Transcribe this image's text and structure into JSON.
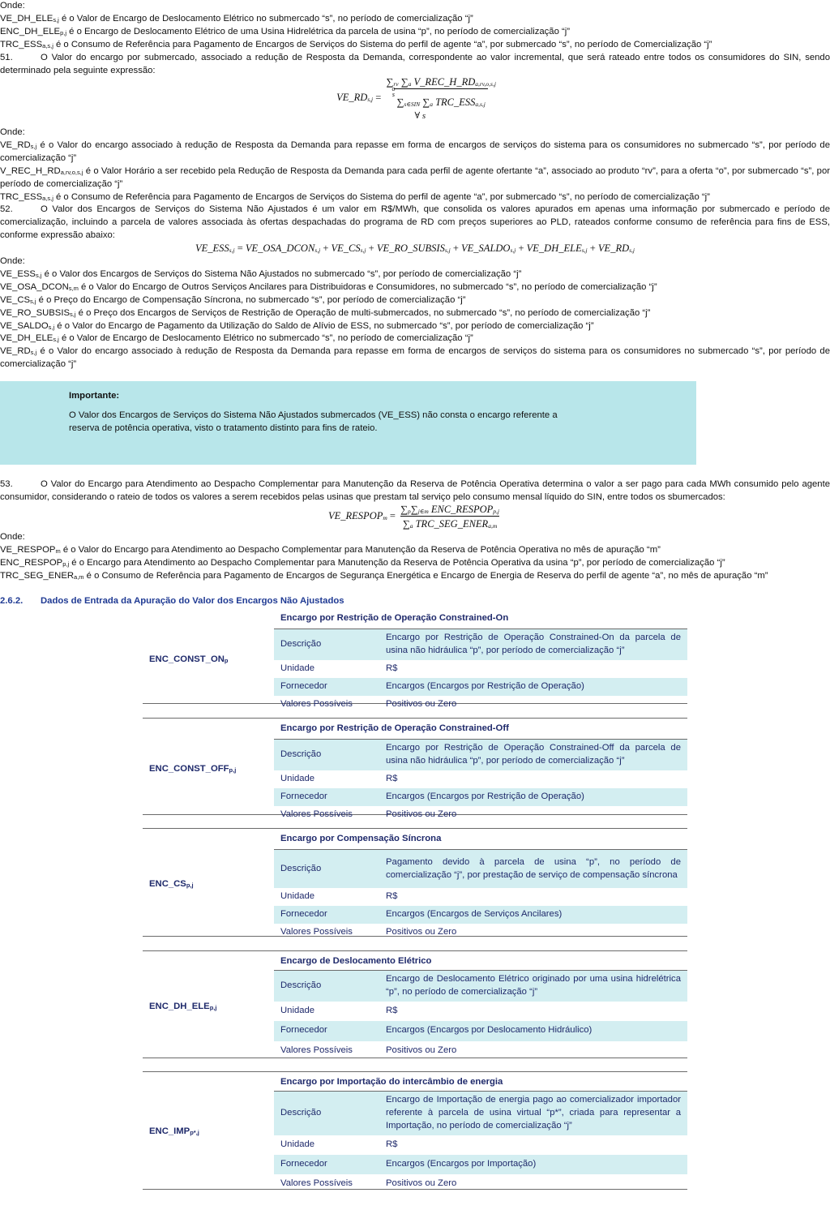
{
  "intro": {
    "onde": "Onde:",
    "defs1": [
      {
        "sym": "VE_DH_ELE",
        "sub": "s,j",
        "text": " é o Valor de Encargo de Deslocamento Elétrico no submercado “s”, no período de comercialização “j”"
      },
      {
        "sym": "ENC_DH_ELE",
        "sub": "p,j",
        "text": " é o Encargo de Deslocamento Elétrico de uma Usina Hidrelétrica da parcela de usina “p”, no período de comercialização “j”"
      },
      {
        "sym": "TRC_ESS",
        "sub": "a,s,j",
        "text": " é o Consumo de Referência para Pagamento de Encargos de Serviços do Sistema do perfil de agente “a”, por submercado “s”, no período de Comercialização “j”"
      }
    ]
  },
  "item51": {
    "num": "51.",
    "text": "O Valor do encargo por submercado, associado a redução de Resposta da Demanda, correspondente ao valor incremental, que será rateado entre todos os consumidores do SIN, sendo determinado pela seguinte expressão:",
    "eq_lhs": "VE_RD",
    "eq_lhs_sub": "s,j",
    "eq_num_a": "∑",
    "eq_num_rv": "rv",
    "eq_num_o": "o",
    "eq_num_s": "s",
    "eq_num_b": "∑",
    "eq_num_a2": "a",
    "eq_num_term": "V_REC_H_RD",
    "eq_num_sub": "a,rv,o,s,j",
    "eq_den_sum1": "∑",
    "eq_den_sub1": "s∈SIN",
    "eq_den_sum2": "∑",
    "eq_den_sub2": "a",
    "eq_den_term": "TRC_ESS",
    "eq_den_sub": "a,s,j",
    "eq_forall": "∀ s",
    "onde": "Onde:",
    "defs": [
      {
        "sym": "VE_RD",
        "sub": "s,j",
        "text": " é o Valor do encargo associado à redução de Resposta da Demanda para repasse em forma de encargos de serviços do sistema para os consumidores no submercado “s”, por período de comercialização “j”"
      },
      {
        "sym": "V_REC_H_RD",
        "sub": "a,rv,o,s,j",
        "text": " é o Valor Horário a ser recebido pela Redução de Resposta da Demanda para cada perfil de agente ofertante “a”, associado ao produto “rv”, para a oferta “o”, por submercado “s”, por período de comercialização “j”"
      },
      {
        "sym": "TRC_ESS",
        "sub": "a,s,j",
        "text": " é o Consumo de Referência para Pagamento de Encargos de Serviços do Sistema do perfil de agente “a”, por submercado “s”, no período de comercialização “j”"
      }
    ]
  },
  "item52": {
    "num": "52.",
    "text": "O Valor dos Encargos de Serviços do Sistema Não Ajustados é um valor em R$/MWh, que consolida os valores apurados em apenas uma informação por submercado e período de comercialização, incluindo a parcela de valores associada às ofertas despachadas do programa de RD com preços superiores ao PLD, rateados conforme consumo de referência para fins de ESS, conforme expressão abaixo:",
    "eq": [
      {
        "t": "VE_ESS",
        "s": "s,j"
      },
      {
        "op": " = "
      },
      {
        "t": "VE_OSA_DCON",
        "s": "s,j"
      },
      {
        "op": " + "
      },
      {
        "t": "VE_CS",
        "s": "s,j"
      },
      {
        "op": " + "
      },
      {
        "t": "VE_RO_SUBSIS",
        "s": "s,j"
      },
      {
        "op": " + "
      },
      {
        "t": "VE_SALDO",
        "s": "s,j"
      },
      {
        "op": " + "
      },
      {
        "t": "VE_DH_ELE",
        "s": "s,j"
      },
      {
        "op": " + "
      },
      {
        "t": "VE_RD",
        "s": "s,j"
      }
    ],
    "onde": "Onde:",
    "defs": [
      {
        "sym": "VE_ESS",
        "sub": "s,j",
        "text": " é o Valor dos Encargos de Serviços do Sistema Não Ajustados no submercado “s”, por período de comercialização “j”"
      },
      {
        "sym": "VE_OSA_DCON",
        "sub": "s,m",
        "text": " é o Valor do Encargo de Outros Serviços Ancilares para Distribuidoras e Consumidores, no submercado “s”, no período de comercialização “j”"
      },
      {
        "sym": "VE_CS",
        "sub": "s,j",
        "text": " é o Preço do Encargo de Compensação Síncrona, no submercado “s”, por período de comercialização “j”"
      },
      {
        "sym": "VE_RO_SUBSIS",
        "sub": "s,j",
        "text": " é o Preço dos Encargos de Serviços de Restrição de Operação de multi-submercados, no submercado “s”, no período de comercialização “j”"
      },
      {
        "sym": "VE_SALDO",
        "sub": "s,j",
        "text": " é o Valor do Encargo de Pagamento da Utilização do Saldo de Alívio de ESS, no submercado “s”, por período de comercialização “j”"
      },
      {
        "sym": "VE_DH_ELE",
        "sub": "s,j",
        "text": " é o Valor de Encargo de Deslocamento Elétrico no submercado “s”, no período de comercialização “j”"
      },
      {
        "sym": "VE_RD",
        "sub": "s,j",
        "text": " é o Valor do encargo associado à redução de Resposta da Demanda para repasse em forma de encargos de serviços do sistema para os consumidores no submercado “s”, por período de comercialização “j”"
      }
    ]
  },
  "important": {
    "title": "Importante:",
    "body": "O Valor dos Encargos de Serviços do Sistema Não Ajustados submercados (VE_ESS) não consta o encargo referente a reserva de potência operativa, visto o tratamento distinto para fins de rateio."
  },
  "item53": {
    "num": "53.",
    "text": "O Valor do Encargo para Atendimento ao Despacho Complementar para Manutenção da Reserva de Potência Operativa determina o valor a ser pago para cada MWh consumido pelo agente consumidor, considerando o rateio de todos os valores a serem recebidos pelas usinas que prestam tal serviço pelo consumo mensal líquido do SIN, entre todos os sbumercados:",
    "eq_lhs": "VE_RESPOP",
    "eq_lhs_sub": "m",
    "eq_num": "∑",
    "eq_num_p": "p",
    "eq_num2": "∑",
    "eq_num_j": "j∈m",
    "eq_num_term": "ENC_RESPOP",
    "eq_num_sub": "p,j",
    "eq_den": "∑",
    "eq_den_a": "a",
    "eq_den_term": "TRC_SEG_ENER",
    "eq_den_sub": "a,m",
    "onde": "Onde:",
    "defs": [
      {
        "sym": "VE_RESPOP",
        "sub": "m",
        "text": " é o Valor do Encargo para Atendimento ao Despacho Complementar para Manutenção da Reserva de Potência Operativa no mês de apuração “m”"
      },
      {
        "sym": "ENC_RESPOP",
        "sub": "p,j",
        "text": " é o Encargo para Atendimento ao Despacho Complementar para Manutenção da Reserva de Potência Operativa da usina “p”, por período de comercialização “j”"
      },
      {
        "sym": "TRC_SEG_ENER",
        "sub": "a,m",
        "text": " é o Consumo de Referência para Pagamento de Encargos de Segurança Energética e Encargo de Energia de Reserva do perfil de agente “a”, no mês de apuração “m”"
      }
    ]
  },
  "section": {
    "num": "2.6.2.",
    "title": "Dados de Entrada da Apuração do Valor dos Encargos Não Ajustados"
  },
  "tables": [
    {
      "param": "ENC_CONST_ON",
      "sub": "p",
      "head": "Encargo por Restrição de Operação Constrained-On",
      "rows": [
        {
          "k": "Descrição",
          "v": "Encargo por Restrição de Operação Constrained-On da parcela de usina não hidráulica “p”, por período de comercialização “j”"
        },
        {
          "k": "Unidade",
          "v": "R$"
        },
        {
          "k": "Fornecedor",
          "v": "Encargos (Encargos por Restrição de Operação)"
        },
        {
          "k": "Valores Possíveis",
          "v": "Positivos ou Zero"
        }
      ]
    },
    {
      "param": "ENC_CONST_OFF",
      "sub": "p,j",
      "head": "Encargo por Restrição de Operação Constrained-Off",
      "rows": [
        {
          "k": "Descrição",
          "v": "Encargo por Restrição de Operação Constrained-Off da parcela de usina não hidráulica “p”, por período de comercialização “j”"
        },
        {
          "k": "Unidade",
          "v": "R$"
        },
        {
          "k": "Fornecedor",
          "v": "Encargos (Encargos por Restrição de Operação)"
        },
        {
          "k": "Valores Possíveis",
          "v": "Positivos ou Zero"
        }
      ]
    },
    {
      "param": "ENC_CS",
      "sub": "p,j",
      "head": "Encargo por Compensação Síncrona",
      "rows": [
        {
          "k": "Descrição",
          "v": "Pagamento devido à parcela de usina “p”, no período de comercialização “j”, por prestação de serviço de compensação síncrona"
        },
        {
          "k": "Unidade",
          "v": "R$"
        },
        {
          "k": "Fornecedor",
          "v": "Encargos (Encargos de Serviços Ancilares)"
        },
        {
          "k": "Valores Possíveis",
          "v": "Positivos ou Zero"
        }
      ]
    },
    {
      "param": "ENC_DH_ELE",
      "sub": "p,j",
      "head": "Encargo de Deslocamento Elétrico",
      "rows": [
        {
          "k": "Descrição",
          "v": "Encargo de Deslocamento Elétrico originado por uma usina hidrelétrica “p”, no período de comercialização “j”"
        },
        {
          "k": "Unidade",
          "v": "R$"
        },
        {
          "k": "Fornecedor",
          "v": "Encargos (Encargos por Deslocamento Hidráulico)"
        },
        {
          "k": "Valores Possíveis",
          "v": "Positivos ou Zero"
        }
      ]
    },
    {
      "param": "ENC_IMP",
      "sub": "p*,j",
      "head": "Encargo por Importação do intercâmbio de energia",
      "rows": [
        {
          "k": "Descrição",
          "v": "Encargo de Importação de energia pago ao comercializador importador referente à parcela de usina virtual “p*”, criada para representar a Importação, no período de comercialização “j”"
        },
        {
          "k": "Unidade",
          "v": "R$"
        },
        {
          "k": "Fornecedor",
          "v": "Encargos (Encargos por Importação)"
        },
        {
          "k": "Valores Possíveis",
          "v": "Positivos ou Zero"
        }
      ]
    }
  ]
}
